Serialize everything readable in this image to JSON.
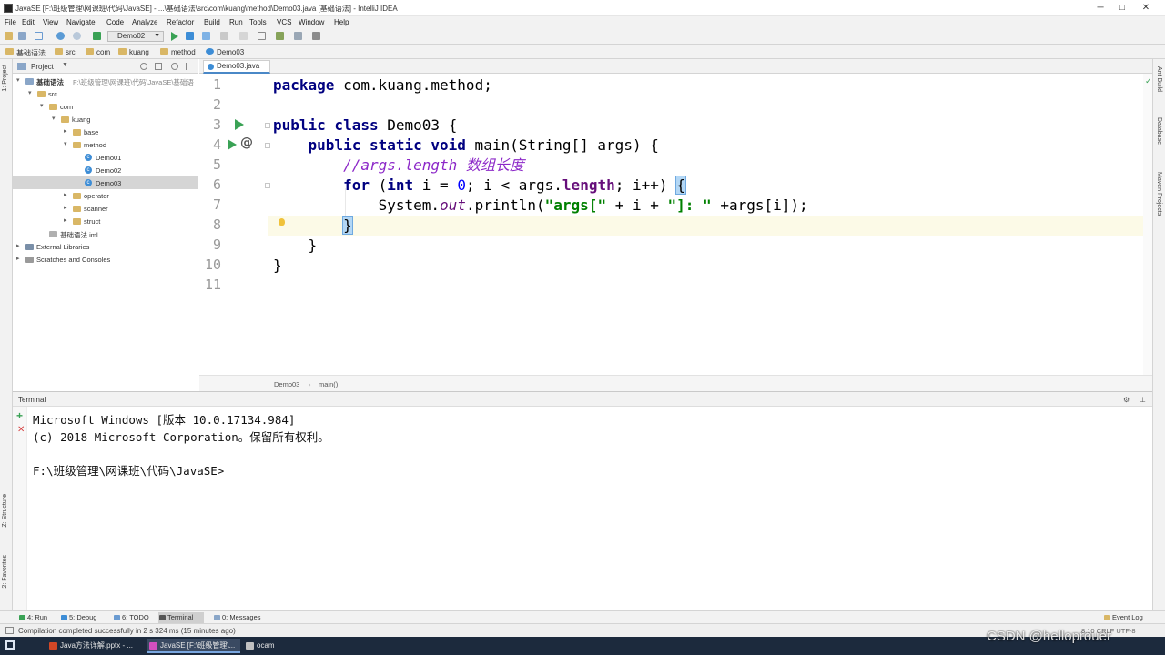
{
  "window": {
    "title": "JavaSE [F:\\班级管理\\网课班\\代码\\JavaSE] - ...\\基础语法\\src\\com\\kuang\\method\\Demo03.java [基础语法] - IntelliJ IDEA",
    "minimize": "─",
    "restore": "□",
    "close": "✕"
  },
  "menu": [
    "File",
    "Edit",
    "View",
    "Navigate",
    "Code",
    "Analyze",
    "Refactor",
    "Build",
    "Run",
    "Tools",
    "VCS",
    "Window",
    "Help"
  ],
  "toolbar": {
    "run_config": "Demo02",
    "colors": {
      "run": "#3aa255",
      "debug": "#3d8dd6",
      "stop": "#c94b4b"
    }
  },
  "breadcrumbs": [
    "基础语法",
    "src",
    "com",
    "kuang",
    "method",
    "Demo03"
  ],
  "left_strip": {
    "project": "1: Project",
    "structure": "Z: Structure",
    "favorites": "2: Favorites"
  },
  "right_strip": {
    "ant": "Ant Build",
    "database": "Database",
    "maven": "Maven Projects"
  },
  "project_panel": {
    "title": "Project",
    "tree": [
      {
        "label": "基础语法",
        "sub": "F:\\班级管理\\网课班\\代码\\JavaSE\\基础语",
        "indent": 0,
        "type": "module",
        "open": true
      },
      {
        "label": "src",
        "indent": 1,
        "type": "folder",
        "open": true
      },
      {
        "label": "com",
        "indent": 2,
        "type": "folder",
        "open": true
      },
      {
        "label": "kuang",
        "indent": 3,
        "type": "folder",
        "open": true
      },
      {
        "label": "base",
        "indent": 4,
        "type": "folder",
        "open": false
      },
      {
        "label": "method",
        "indent": 4,
        "type": "folder",
        "open": true
      },
      {
        "label": "Demo01",
        "indent": 5,
        "type": "class"
      },
      {
        "label": "Demo02",
        "indent": 5,
        "type": "class"
      },
      {
        "label": "Demo03",
        "indent": 5,
        "type": "class",
        "selected": true
      },
      {
        "label": "operator",
        "indent": 4,
        "type": "folder",
        "open": false
      },
      {
        "label": "scanner",
        "indent": 4,
        "type": "folder",
        "open": false
      },
      {
        "label": "struct",
        "indent": 4,
        "type": "folder",
        "open": false
      },
      {
        "label": "基础语法.iml",
        "indent": 2,
        "type": "file"
      },
      {
        "label": "External Libraries",
        "indent": 0,
        "type": "lib",
        "open": false
      },
      {
        "label": "Scratches and Consoles",
        "indent": 0,
        "type": "scratch",
        "open": false
      }
    ]
  },
  "editor": {
    "tab": "Demo03.java",
    "line_numbers": [
      "1",
      "2",
      "3",
      "4",
      "5",
      "6",
      "7",
      "8",
      "9",
      "10",
      "11"
    ],
    "lines": [
      [
        {
          "t": "package",
          "c": "kw"
        },
        {
          "t": " com.kuang.method;",
          "c": ""
        }
      ],
      [],
      [
        {
          "t": "public class",
          "c": "kw"
        },
        {
          "t": " Demo03 {",
          "c": ""
        }
      ],
      [
        {
          "t": "    "
        },
        {
          "t": "public static void",
          "c": "kw"
        },
        {
          "t": " main(String[] args) {",
          "c": ""
        }
      ],
      [
        {
          "t": "        "
        },
        {
          "t": "//args.length 数组长度",
          "c": "cmt"
        }
      ],
      [
        {
          "t": "        "
        },
        {
          "t": "for",
          "c": "kw"
        },
        {
          "t": " ("
        },
        {
          "t": "int",
          "c": "kw"
        },
        {
          "t": " i = "
        },
        {
          "t": "0",
          "c": "num"
        },
        {
          "t": "; i < args."
        },
        {
          "t": "length",
          "c": "fld"
        },
        {
          "t": "; i++) "
        },
        {
          "t": "{",
          "c": "brace-hl"
        }
      ],
      [
        {
          "t": "            System."
        },
        {
          "t": "out",
          "c": "sfld"
        },
        {
          "t": ".println("
        },
        {
          "t": "\"args[\"",
          "c": "str"
        },
        {
          "t": " + i + "
        },
        {
          "t": "\"]: \"",
          "c": "str"
        },
        {
          "t": " +args[i]);"
        }
      ],
      [
        {
          "t": "        "
        },
        {
          "t": "}",
          "c": "brace-hl"
        }
      ],
      [
        {
          "t": "    }"
        }
      ],
      [
        {
          "t": "}"
        }
      ],
      []
    ],
    "breadcrumb": [
      "Demo03",
      "main()"
    ]
  },
  "terminal": {
    "title": "Terminal",
    "lines": [
      "Microsoft Windows [版本 10.0.17134.984]",
      "(c) 2018 Microsoft Corporation。保留所有权利。",
      "",
      "F:\\班级管理\\网课班\\代码\\JavaSE>"
    ]
  },
  "bottom_tabs": [
    "4: Run",
    "5: Debug",
    "6: TODO",
    "Terminal",
    "0: Messages"
  ],
  "event_log": "Event Log",
  "status": {
    "message": "Compilation completed successfully in 2 s 324 ms (15 minutes ago)",
    "position": "8:10  CRLF  UTF-8"
  },
  "taskbar": [
    {
      "label": "Java方法详解.pptx - ...",
      "color": "#d24726"
    },
    {
      "label": "JavaSE [F:\\班级管理\\...",
      "color": "#d24fbf",
      "active": true
    },
    {
      "label": "ocam",
      "color": "#c0c0c0"
    }
  ],
  "watermark": "CSDN @helloprouer"
}
